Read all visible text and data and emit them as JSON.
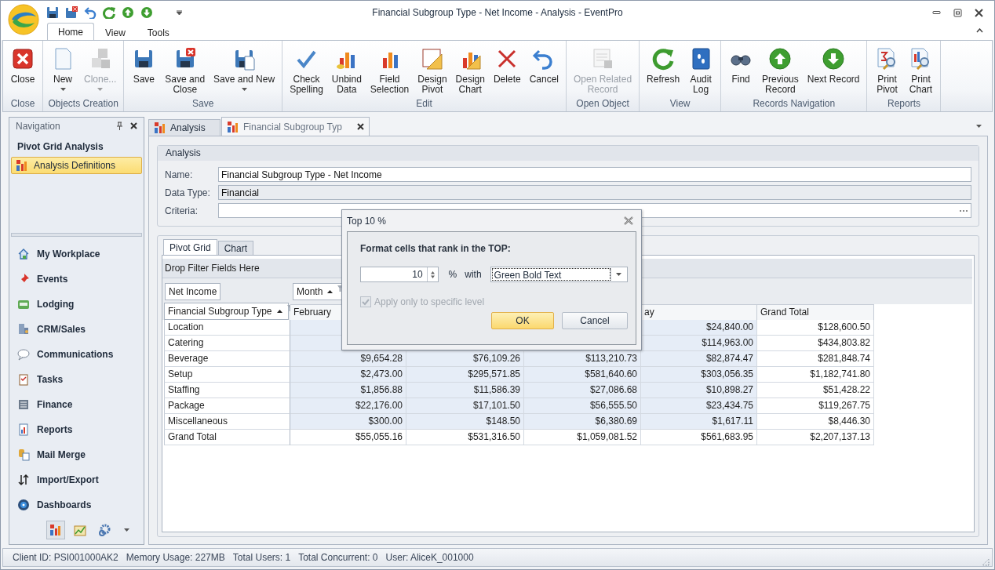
{
  "window": {
    "title": "Financial Subgroup Type - Net Income - Analysis - EventPro"
  },
  "ribbon_tabs": [
    {
      "label": "Home",
      "selected": true
    },
    {
      "label": "View",
      "selected": false
    },
    {
      "label": "Tools",
      "selected": false
    }
  ],
  "ribbon": {
    "groups": [
      {
        "label": "Close",
        "buttons": [
          {
            "label": "Close",
            "disabled": false,
            "menu": false
          }
        ]
      },
      {
        "label": "Objects Creation",
        "buttons": [
          {
            "label": "New",
            "disabled": false,
            "menu": true
          },
          {
            "label": "Clone...",
            "disabled": true,
            "menu": true
          }
        ]
      },
      {
        "label": "Save",
        "buttons": [
          {
            "label": "Save",
            "disabled": false,
            "menu": false
          },
          {
            "label": "Save and\nClose",
            "disabled": false,
            "menu": false
          },
          {
            "label": "Save and New",
            "disabled": false,
            "menu": true
          }
        ]
      },
      {
        "label": "Edit",
        "buttons": [
          {
            "label": "Check\nSpelling",
            "disabled": false,
            "menu": false
          },
          {
            "label": "Unbind\nData",
            "disabled": false,
            "menu": false
          },
          {
            "label": "Field\nSelection",
            "disabled": false,
            "menu": false
          },
          {
            "label": "Design\nPivot",
            "disabled": false,
            "menu": false
          },
          {
            "label": "Design\nChart",
            "disabled": false,
            "menu": false
          },
          {
            "label": "Delete",
            "disabled": false,
            "menu": false
          },
          {
            "label": "Cancel",
            "disabled": false,
            "menu": false
          }
        ]
      },
      {
        "label": "Open Object",
        "buttons": [
          {
            "label": "Open Related\nRecord",
            "disabled": true,
            "menu": false
          }
        ]
      },
      {
        "label": "View",
        "buttons": [
          {
            "label": "Refresh",
            "disabled": false,
            "menu": false
          },
          {
            "label": "Audit\nLog",
            "disabled": false,
            "menu": false
          }
        ]
      },
      {
        "label": "Records Navigation",
        "buttons": [
          {
            "label": "Find",
            "disabled": false,
            "menu": false
          },
          {
            "label": "Previous\nRecord",
            "disabled": false,
            "menu": false
          },
          {
            "label": "Next Record",
            "disabled": false,
            "menu": false
          }
        ]
      },
      {
        "label": "Reports",
        "buttons": [
          {
            "label": "Print\nPivot",
            "disabled": false,
            "menu": false
          },
          {
            "label": "Print\nChart",
            "disabled": false,
            "menu": false
          }
        ]
      }
    ]
  },
  "navigation": {
    "title": "Navigation",
    "section": "Pivot Grid Analysis",
    "items": [
      {
        "label": "Analysis Definitions",
        "selected": true
      }
    ],
    "modules": [
      "My Workplace",
      "Events",
      "Lodging",
      "CRM/Sales",
      "Communications",
      "Tasks",
      "Finance",
      "Reports",
      "Mail Merge",
      "Import/Export",
      "Dashboards"
    ],
    "toolbar": [
      {
        "selected": true
      },
      {
        "selected": false
      },
      {
        "selected": false
      }
    ]
  },
  "document_tabs": [
    {
      "label": "Analysis",
      "selected": false,
      "closable": false
    },
    {
      "label": "Financial Subgroup Typ",
      "selected": true,
      "closable": true
    }
  ],
  "analysis": {
    "title": "Analysis",
    "fields": [
      {
        "label": "Name:",
        "value": "Financial Subgroup Type - Net Income",
        "readonly": false,
        "kind": "text"
      },
      {
        "label": "Data Type:",
        "value": "Financial",
        "readonly": true,
        "kind": "text"
      },
      {
        "label": "Criteria:",
        "readonly": false,
        "kind": "picker"
      }
    ]
  },
  "view_tabs": [
    {
      "label": "Pivot Grid",
      "selected": true
    },
    {
      "label": "Chart",
      "selected": false
    }
  ],
  "pivot": {
    "filter_area": "Drop Filter Fields Here",
    "data_field": {
      "label": "Net Income",
      "sorted_ascending": false,
      "filter": false
    },
    "column_field": {
      "label": "Month",
      "sorted_ascending": true,
      "filter": true
    },
    "row_field": {
      "label": "Financial Subgroup Type",
      "sorted_ascending": true,
      "filter": true
    },
    "columns": {
      "column_1": "February",
      "column_4": "ay",
      "grand_total": "Grand Total"
    },
    "rows": [
      {
        "label": "Location",
        "column_4": "$24,840.00",
        "grand_total": "$128,600.50"
      },
      {
        "label": "Catering",
        "column_4": "$114,963.00",
        "grand_total": "$434,803.82"
      },
      {
        "label": "Beverage",
        "column_1": "$9,654.28",
        "column_2": "$76,109.26",
        "column_3": "$113,210.73",
        "column_4": "$82,874.47",
        "grand_total": "$281,848.74"
      },
      {
        "label": "Setup",
        "column_1": "$2,473.00",
        "column_2": "$295,571.85",
        "column_3": "$581,640.60",
        "column_4": "$303,056.35",
        "grand_total": "$1,182,741.80"
      },
      {
        "label": "Staffing",
        "column_1": "$1,856.88",
        "column_2": "$11,586.39",
        "column_3": "$27,086.68",
        "column_4": "$10,898.27",
        "grand_total": "$51,428.22"
      },
      {
        "label": "Package",
        "column_1": "$22,176.00",
        "column_2": "$17,101.50",
        "column_3": "$56,555.50",
        "column_4": "$23,434.75",
        "grand_total": "$119,267.75"
      },
      {
        "label": "Miscellaneous",
        "column_1": "$300.00",
        "column_2": "$148.50",
        "column_3": "$6,380.69",
        "column_4": "$1,617.11",
        "grand_total": "$8,446.30"
      },
      {
        "label": "Grand Total",
        "column_1": "$55,055.16",
        "column_2": "$531,316.50",
        "column_3": "$1,059,081.52",
        "column_4": "$561,683.95",
        "grand_total": "$2,207,137.13"
      }
    ]
  },
  "dialog": {
    "title": "Top 10 %",
    "heading": "Format cells that rank in the TOP:",
    "spinner": {
      "value": "10"
    },
    "unit": "%",
    "connector": "with",
    "style_select": {
      "value": "Green Bold Text",
      "focused": true
    },
    "checkbox": {
      "label": "Apply only to specific level",
      "checked": true,
      "disabled": true
    },
    "buttons": [
      {
        "label": "OK",
        "default": true
      },
      {
        "label": "Cancel",
        "default": false
      }
    ]
  },
  "status_bar": [
    "Client ID: PSI001000AK2",
    "Memory Usage: 227MB",
    "Total Users: 1",
    "Total Concurrent: 0",
    "User: AliceK_001000"
  ]
}
